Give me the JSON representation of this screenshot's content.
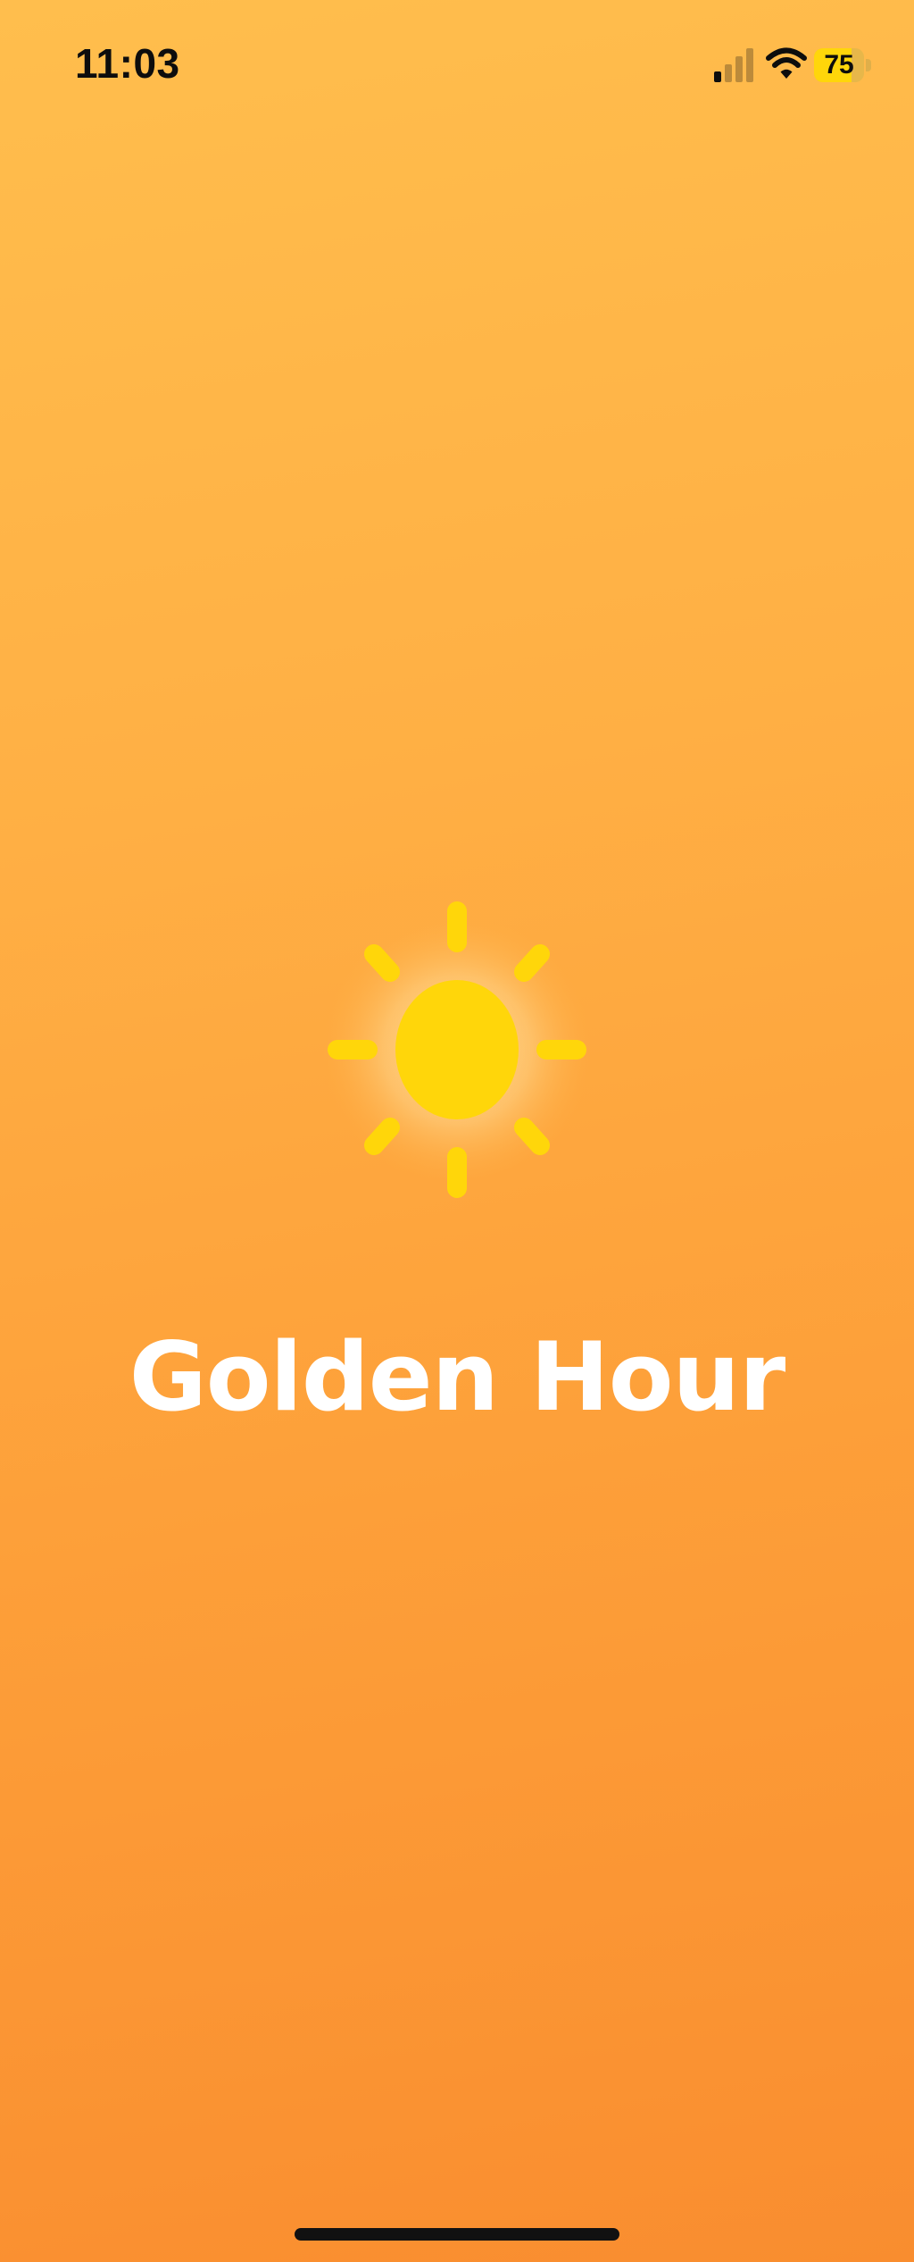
{
  "status_bar": {
    "time": "11:03",
    "battery_level": "75",
    "battery_fraction": 0.75,
    "signal_bars_active": 1,
    "signal_bars_total": 4,
    "icons": [
      "signal-icon",
      "wifi-icon",
      "battery-icon"
    ]
  },
  "main": {
    "logo_icon": "sun-icon",
    "title": "Golden Hour"
  },
  "colors": {
    "background_top": "#FFBE4D",
    "background_bottom": "#F98D2F",
    "sun": "#FFD60A",
    "title": "#FFFFFF"
  }
}
